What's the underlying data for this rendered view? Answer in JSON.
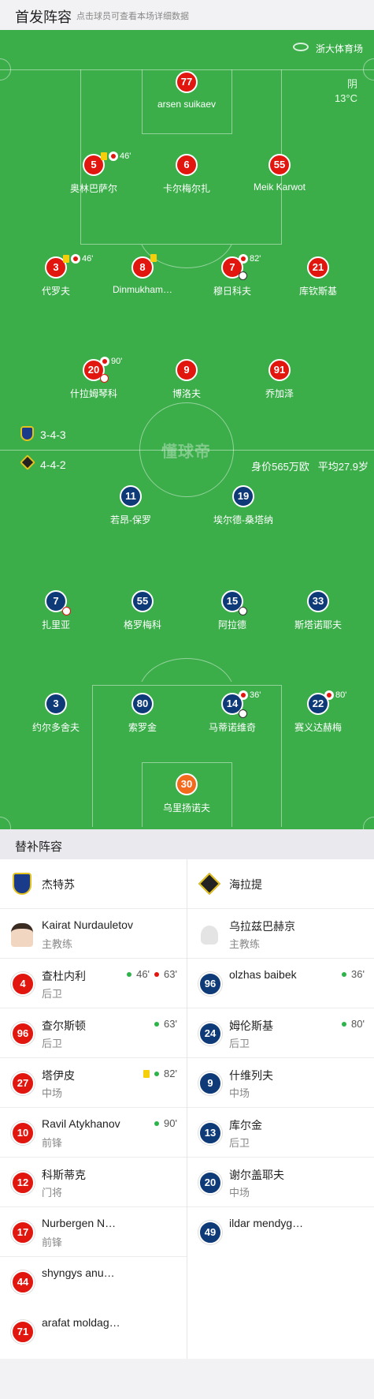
{
  "header": {
    "title": "首发阵容",
    "subtitle": "点击球员可查看本场详细数据"
  },
  "pitch": {
    "venue": "浙大体育场",
    "weather": "阴",
    "temperature": "13°C",
    "watermark": "懂球帝",
    "home_formation": "3-4-3",
    "away_formation": "4-4-2",
    "away_value": "身价565万欧",
    "away_age": "平均27.9岁",
    "colors": {
      "home": "#e0160f",
      "away": "#0e3a78",
      "goalkeeper": "#f26b1d",
      "pitch": "#3bae4a"
    }
  },
  "home_players": [
    {
      "num": "77",
      "name": "arsen suikaev"
    },
    {
      "num": "5",
      "name": "奥林巴萨尔",
      "event": "46'"
    },
    {
      "num": "6",
      "name": "卡尔梅尔扎"
    },
    {
      "num": "55",
      "name": "Meik Karwot"
    },
    {
      "num": "3",
      "name": "代罗夫",
      "event": "46'"
    },
    {
      "num": "8",
      "name": "Dinmukham…"
    },
    {
      "num": "7",
      "name": "穆日科夫",
      "event": "82'"
    },
    {
      "num": "21",
      "name": "库钦斯基"
    },
    {
      "num": "20",
      "name": "什拉姆琴科",
      "event": "90'"
    },
    {
      "num": "9",
      "name": "博洛夫"
    },
    {
      "num": "91",
      "name": "乔加泽"
    }
  ],
  "away_players": [
    {
      "num": "11",
      "name": "若昂-保罗"
    },
    {
      "num": "19",
      "name": "埃尔德-桑塔纳"
    },
    {
      "num": "7",
      "name": "扎里亚"
    },
    {
      "num": "55",
      "name": "格罗梅科"
    },
    {
      "num": "15",
      "name": "阿拉德"
    },
    {
      "num": "33",
      "name": "斯塔诺耶夫"
    },
    {
      "num": "3",
      "name": "约尔多舍夫"
    },
    {
      "num": "80",
      "name": "索罗金"
    },
    {
      "num": "14",
      "name": "马蒂诺维奇",
      "event": "36'"
    },
    {
      "num": "22",
      "name": "赛义达赫梅",
      "event": "80'"
    },
    {
      "num": "30",
      "name": "乌里扬诺夫"
    }
  ],
  "bench": {
    "title": "替补阵容",
    "home_team": "杰特苏",
    "away_team": "海拉提",
    "home_coach": {
      "name": "Kairat Nurdauletov",
      "role": "主教练"
    },
    "away_coach": {
      "name": "乌拉兹巴赫京",
      "role": "主教练"
    },
    "home_subs": [
      {
        "num": "4",
        "name": "查杜内利",
        "pos": "后卫",
        "ev1": "46'",
        "ev2": "63'"
      },
      {
        "num": "96",
        "name": "查尔斯顿",
        "pos": "后卫",
        "ev1": "63'"
      },
      {
        "num": "27",
        "name": "塔伊皮",
        "pos": "中场",
        "ev1": "82'"
      },
      {
        "num": "10",
        "name": "Ravil Atykhanov",
        "pos": "前锋",
        "ev1": "90'"
      },
      {
        "num": "12",
        "name": "科斯蒂克",
        "pos": "门将"
      },
      {
        "num": "17",
        "name": "Nurbergen N…",
        "pos": "前锋"
      },
      {
        "num": "44",
        "name": "shyngys anu…",
        "pos": ""
      },
      {
        "num": "71",
        "name": "arafat moldag…",
        "pos": ""
      }
    ],
    "away_subs": [
      {
        "num": "96",
        "name": "olzhas baibek",
        "pos": "",
        "ev1": "36'"
      },
      {
        "num": "24",
        "name": "姆伦斯基",
        "pos": "后卫",
        "ev1": "80'"
      },
      {
        "num": "9",
        "name": "什维列夫",
        "pos": "中场"
      },
      {
        "num": "13",
        "name": "库尔金",
        "pos": "后卫"
      },
      {
        "num": "20",
        "name": "谢尔盖耶夫",
        "pos": "中场"
      },
      {
        "num": "49",
        "name": "ildar mendyg…",
        "pos": ""
      }
    ]
  }
}
